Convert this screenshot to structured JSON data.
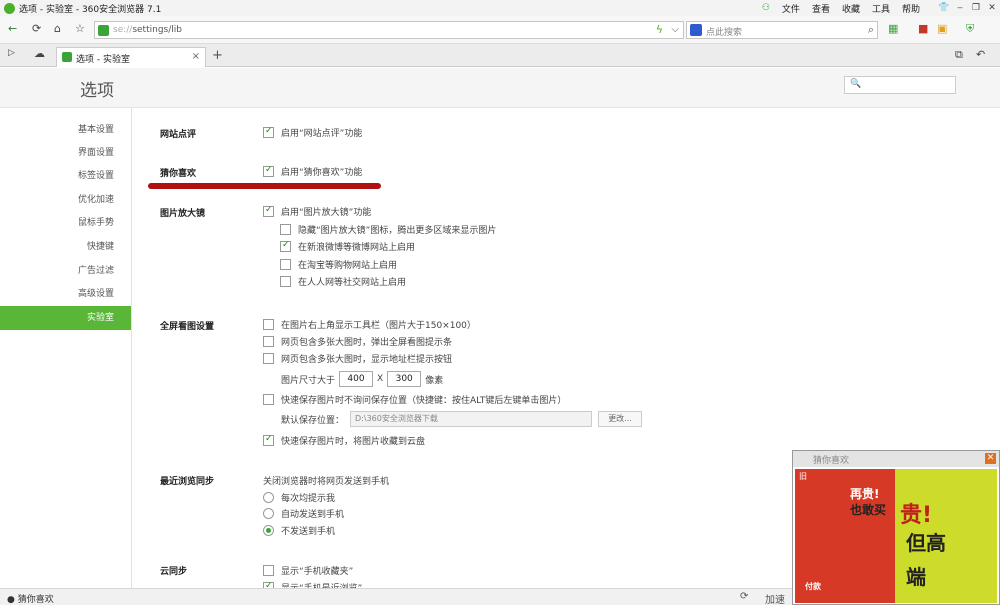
{
  "window": {
    "title": "选项 - 实验室 - 360安全浏览器 7.1",
    "menu": [
      "文件",
      "查看",
      "收藏",
      "工具",
      "帮助"
    ],
    "win_buttons": [
      "❐",
      "‒",
      "❐",
      "✕"
    ]
  },
  "nav": {
    "url_scheme": "se://",
    "url_path": "settings/lib",
    "search_placeholder": "点此搜索",
    "back": "←",
    "forward": "⟳",
    "home": "⌂",
    "fav": "☆"
  },
  "tabs": [
    {
      "label": "选项 - 实验室",
      "close": "×"
    }
  ],
  "new_tab": "+",
  "page": {
    "title": "选项",
    "search_icon": "🔍"
  },
  "sidebar": {
    "items": [
      "基本设置",
      "界面设置",
      "标签设置",
      "优化加速",
      "鼠标手势",
      "快捷键",
      "广告过滤",
      "高级设置",
      "实验室"
    ],
    "active_index": 8
  },
  "settings": {
    "site_review": {
      "title": "网站点评",
      "enable": "启用“网站点评”功能",
      "checked": true
    },
    "guess_like": {
      "title": "猜你喜欢",
      "enable": "启用“猜你喜欢”功能",
      "checked": true
    },
    "magnifier": {
      "title": "图片放大镜",
      "enable": "启用“图片放大镜”功能",
      "options": [
        {
          "label": "隐藏“图片放大镜”图标，腾出更多区域来显示图片",
          "checked": false
        },
        {
          "label": "在新浪微博等微博网站上启用",
          "checked": true
        },
        {
          "label": "在淘宝等购物网站上启用",
          "checked": false
        },
        {
          "label": "在人人网等社交网站上启用",
          "checked": false
        }
      ]
    },
    "fullscreen": {
      "title": "全屏看图设置",
      "options": [
        {
          "label": "在图片右上角显示工具栏（图片大于150×100）",
          "checked": false
        },
        {
          "label": "网页包含多张大图时，弹出全屏看图提示条",
          "checked": false
        },
        {
          "label": "网页包含多张大图时，显示地址栏提示按钮",
          "checked": false
        }
      ],
      "size_label": "图片尺寸大于",
      "width": "400",
      "x": "X",
      "height": "300",
      "unit": "像素",
      "quick_save": {
        "label": "快速保存图片时不询问保存位置（快捷键：按住ALT键后左键单击图片）",
        "checked": false
      },
      "default_path_label": "默认保存位置：",
      "default_path": "D:\\360安全浏览器下载",
      "change_button": "更改...",
      "cloud_save": {
        "label": "快速保存图片时，将图片收藏到云盘",
        "checked": true
      }
    },
    "recent_sync": {
      "title": "最近浏览同步",
      "desc": "关闭浏览器时将网页发送到手机",
      "options": [
        {
          "label": "每次均提示我",
          "checked": false
        },
        {
          "label": "自动发送到手机",
          "checked": false
        },
        {
          "label": "不发送到手机",
          "checked": true
        }
      ]
    },
    "cloud_sync": {
      "title": "云同步",
      "options": [
        {
          "label": "显示“手机收藏夹”",
          "checked": false
        },
        {
          "label": "显示“手机最近浏览”",
          "checked": true
        }
      ]
    }
  },
  "statusbar": {
    "text": "猜你喜欢",
    "accel": "加速"
  },
  "ad": {
    "header": "猜你喜欢",
    "close": "✕",
    "tag": "旧",
    "line1": "再贵!",
    "line2": "也敢买",
    "line3": "贵!",
    "line4": "但高",
    "line5": "端",
    "line6": "付款"
  },
  "colors": {
    "accent": "#5ab636",
    "annotation": "#b01010"
  }
}
